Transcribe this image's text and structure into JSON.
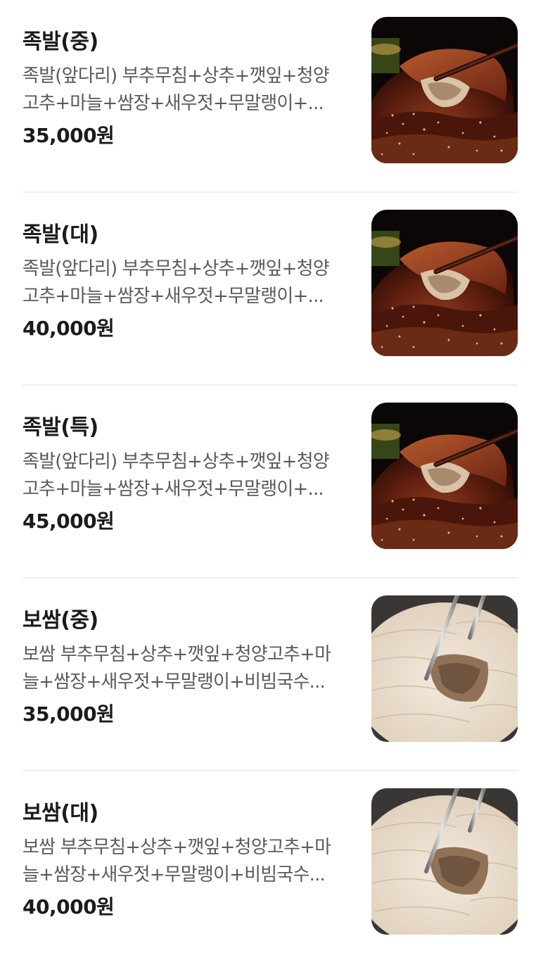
{
  "menu": {
    "items": [
      {
        "name": "족발(중)",
        "desc_line1": "족발(앞다리) 부추무침+상추+깻잎+청양",
        "desc_line2": "고추+마늘+쌈장+새우젓+무말랭이+...",
        "price": "35,000원",
        "image": "jokbal-photo"
      },
      {
        "name": "족발(대)",
        "desc_line1": "족발(앞다리) 부추무침+상추+깻잎+청양",
        "desc_line2": "고추+마늘+쌈장+새우젓+무말랭이+...",
        "price": "40,000원",
        "image": "jokbal-photo"
      },
      {
        "name": "족발(특)",
        "desc_line1": "족발(앞다리) 부추무침+상추+깻잎+청양",
        "desc_line2": "고추+마늘+쌈장+새우젓+무말랭이+...",
        "price": "45,000원",
        "image": "jokbal-photo"
      },
      {
        "name": "보쌈(중)",
        "desc_line1": "보쌈 부추무침+상추+깻잎+청양고추+마",
        "desc_line2": "늘+쌈장+새우젓+무말랭이+비빔국수...",
        "price": "35,000원",
        "image": "bossam-photo"
      },
      {
        "name": "보쌈(대)",
        "desc_line1": "보쌈 부추무침+상추+깻잎+청양고추+마",
        "desc_line2": "늘+쌈장+새우젓+무말랭이+비빔국수...",
        "price": "40,000원",
        "image": "bossam-photo"
      }
    ]
  }
}
